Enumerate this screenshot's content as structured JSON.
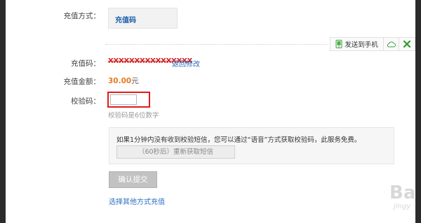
{
  "labels": {
    "method": "充值方式：",
    "code": "充值码：",
    "amount": "充值金额：",
    "verify": "校验码："
  },
  "method_box": {
    "value": "充值码"
  },
  "toolbar": {
    "send_to_phone": "发送到手机",
    "cloud_icon": "cloud-icon",
    "close_icon": "green-x-icon"
  },
  "recharge_code": {
    "value": "XXXXXXXXXXXXXXXX",
    "return_link": "返回修改"
  },
  "amount": {
    "value": "30.00",
    "unit": "元"
  },
  "verify": {
    "value": "",
    "hint": "校验码是6位数字"
  },
  "notice": {
    "text": "如果1分钟内没有收到校验短信，您可以通过“语音”方式获取校验码，此服务免费。",
    "resend_button": "（60秒后）重新获取短信"
  },
  "submit_button": "确认提交",
  "other_method_link": "选择其他方式充值",
  "watermark": {
    "big": "Ba",
    "small": "jingy"
  },
  "colors": {
    "accent_orange": "#e8791c",
    "link_blue": "#2a6fc0",
    "highlight_red": "#e01b1b"
  }
}
